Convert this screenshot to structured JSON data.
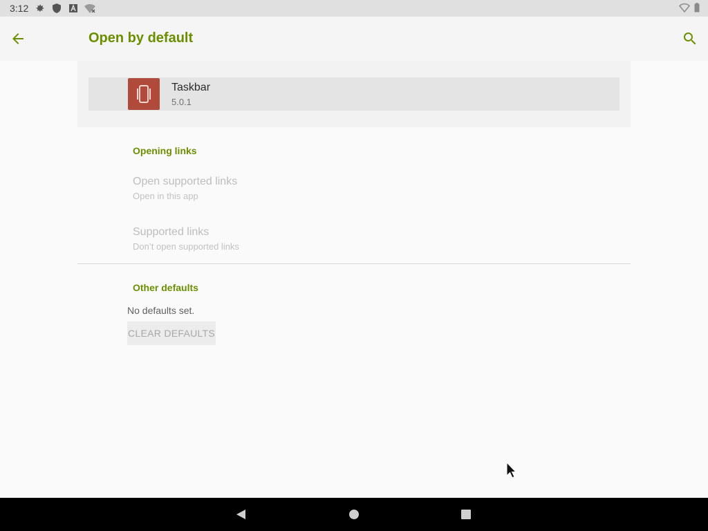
{
  "status_bar": {
    "time": "3:12",
    "left_icons": [
      "gear-icon",
      "shield-icon",
      "a-badge-icon",
      "no-wifi-icon"
    ],
    "right_icons": [
      "wifi-icon",
      "battery-icon"
    ]
  },
  "app_bar": {
    "title": "Open by default",
    "back_icon": "arrow-back-icon",
    "search_icon": "search-icon",
    "accent_color": "#6b8e00"
  },
  "app": {
    "name": "Taskbar",
    "version": "5.0.1",
    "icon_color": "#b04a3a"
  },
  "opening_links": {
    "header": "Opening links",
    "items": [
      {
        "title": "Open supported links",
        "subtitle": "Open in this app"
      },
      {
        "title": "Supported links",
        "subtitle": "Don’t open supported links"
      }
    ]
  },
  "other_defaults": {
    "header": "Other defaults",
    "message": "No defaults set.",
    "clear_button": "CLEAR DEFAULTS"
  },
  "nav_bar": {
    "icons": [
      "nav-back-icon",
      "nav-home-icon",
      "nav-recents-icon"
    ]
  }
}
